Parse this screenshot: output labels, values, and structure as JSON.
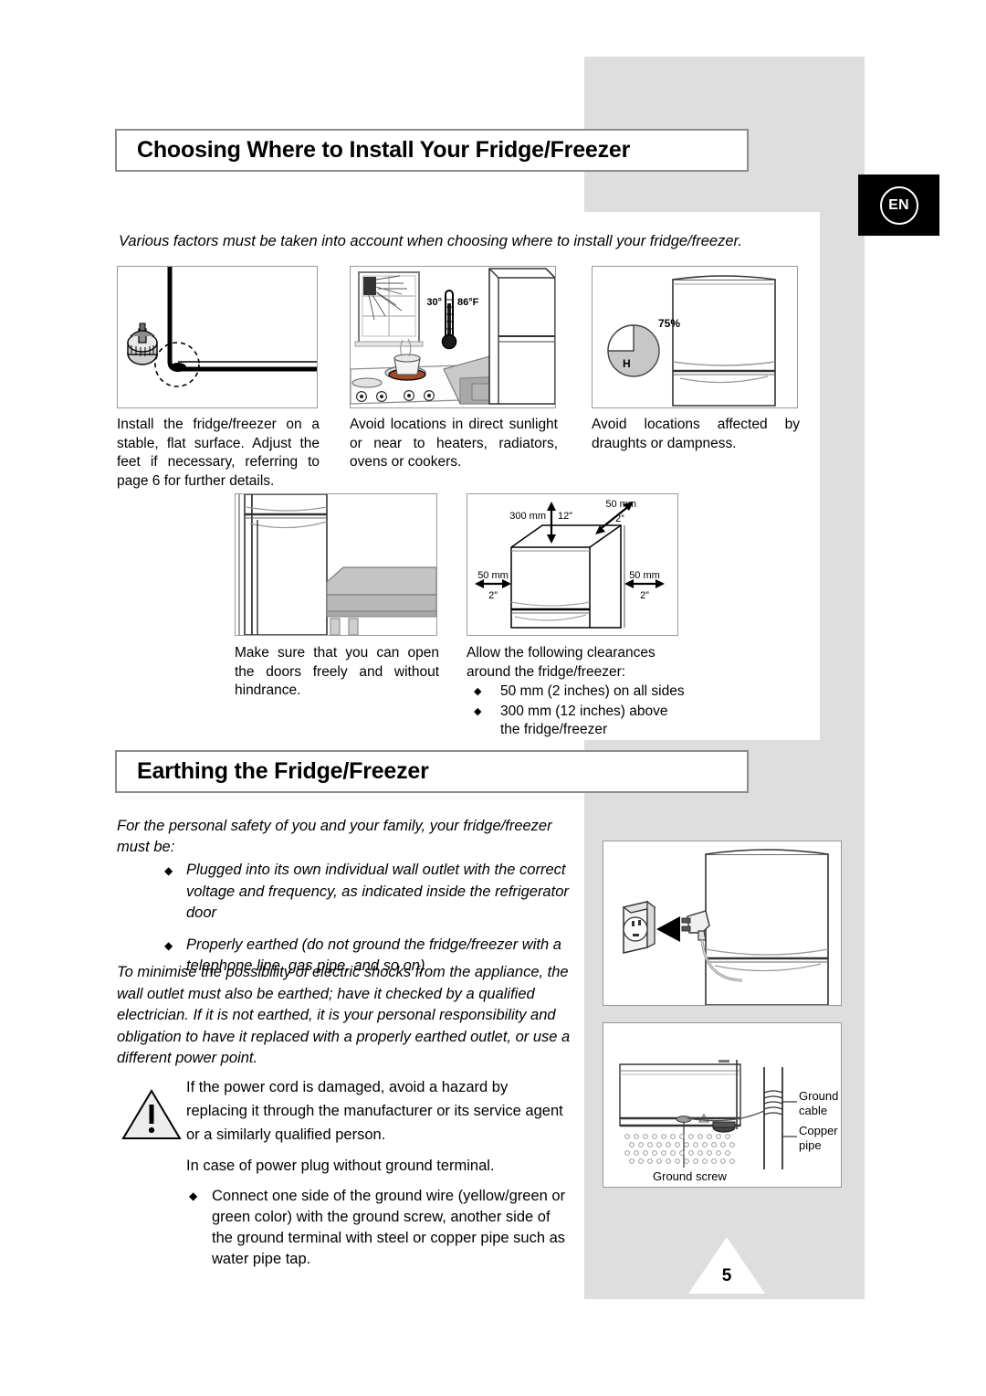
{
  "document": {
    "language_badge": "EN",
    "page_number": "5"
  },
  "section_install": {
    "title": "Choosing Where to Install Your Fridge/Freezer",
    "intro": "Various factors must be taken into account when choosing where to install your fridge/freezer.",
    "figures": [
      {
        "name": "level-surface",
        "caption": "Install the fridge/freezer on a stable, flat surface. Adjust the feet if necessary, referring to page 6 for further details."
      },
      {
        "name": "direct-sunlight",
        "caption": "Avoid locations in direct sunlight or near to heaters, radiators, ovens or cookers.",
        "labels": {
          "temp_low": "30°",
          "temp_high": "86°F"
        }
      },
      {
        "name": "draughts-dampness",
        "caption": "Avoid locations affected by draughts or dampness.",
        "labels": {
          "humidity": "75%",
          "humidity_symbol": "H"
        }
      },
      {
        "name": "door-clearance",
        "caption": "Make sure that you can open the doors freely and without hindrance."
      },
      {
        "name": "air-clearance",
        "caption_line1": "Allow the following clearances",
        "caption_line2": "around the fridge/freezer:",
        "bullets": [
          "50 mm (2 inches) on all sides",
          "300 mm (12 inches) above the fridge/freezer"
        ],
        "labels": {
          "top_mm": "300 mm",
          "top_in": "12”",
          "corner_mm": "50 mm",
          "corner_in": "2”",
          "left_mm": "50 mm",
          "left_in": "2”",
          "right_mm": "50 mm",
          "right_in": "2”"
        }
      }
    ]
  },
  "section_earthing": {
    "title": "Earthing the Fridge/Freezer",
    "intro": "For the personal safety of you and your family, your fridge/freezer must be:",
    "bullets": [
      "Plugged into its own individual wall outlet with the correct voltage and frequency, as indicated inside the refrigerator door",
      "Properly earthed (do not ground the fridge/freezer with a telephone line, gas pipe, and so on)"
    ],
    "paragraph": "To minimise the possibility of electric shocks from the appliance, the wall outlet must also be earthed; have it checked by a qualified electrician. If it is not earthed, it is your personal responsibility and obligation to have it replaced with a properly earthed outlet, or use a different power point.",
    "warning": {
      "para1": "If the power cord is damaged, avoid a hazard by replacing it through the manufacturer or its service agent or a similarly qualified person.",
      "para2": "In case of power plug without ground terminal.",
      "bullet": "Connect one side of the ground wire (yellow/green or green color) with the ground screw, another side of the ground terminal with steel or copper pipe such as water pipe tap."
    },
    "figures": [
      {
        "name": "wall-outlet-plug"
      },
      {
        "name": "ground-screw-detail",
        "labels": {
          "ground_cable_line1": "Ground",
          "ground_cable_line2": "cable",
          "copper_pipe_line1": "Copper",
          "copper_pipe_line2": "pipe",
          "ground_screw": "Ground screw"
        }
      }
    ]
  },
  "colors": {
    "band_gray": "#dedede",
    "frame_gray": "#9a9a9a",
    "title_border": "#8c8c8c",
    "ink": "#000000"
  },
  "icons": {
    "bullet_diamond": "◆",
    "warning": "warning-triangle-icon"
  }
}
